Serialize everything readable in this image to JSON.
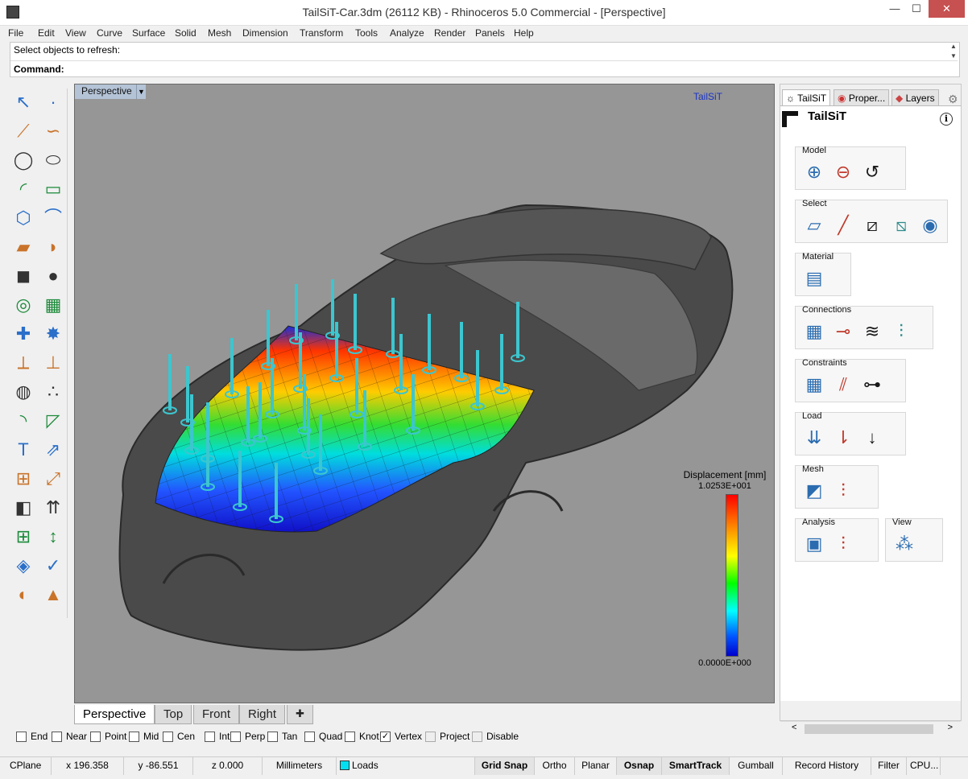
{
  "window": {
    "title": "TailSiT-Car.3dm (26112 KB) - Rhinoceros 5.0 Commercial - [Perspective]",
    "min": "—",
    "max": "☐",
    "close": "✕"
  },
  "menu": [
    "File",
    "Edit",
    "View",
    "Curve",
    "Surface",
    "Solid",
    "Mesh",
    "Dimension",
    "Transform",
    "Tools",
    "Analyze",
    "Render",
    "Panels",
    "Help"
  ],
  "command": {
    "history": "Select objects to refresh:",
    "prompt": "Command:",
    "up": "▲",
    "down": "▼"
  },
  "toolbar": {
    "icons": [
      "select-arrow-icon",
      "point-icon",
      "polyline-icon",
      "curve-icon",
      "circle-icon",
      "ellipse-icon",
      "arc-icon",
      "rectangle-icon",
      "polygon-icon",
      "fillet-icon",
      "surface-corner-icon",
      "surface-sweep-icon",
      "box-icon",
      "sphere-icon",
      "cylinder-icon",
      "mesh-plane-icon",
      "join-icon",
      "explode-icon",
      "trim-icon",
      "split-icon",
      "boolean-icon",
      "group-icon",
      "offset-icon",
      "chamfer-icon",
      "text-icon",
      "move-icon",
      "array-icon",
      "scale-icon",
      "layer-box-icon",
      "loads-arrows-icon",
      "grid-array-icon",
      "dimension-icon",
      "render-icon",
      "check-icon",
      "shade-icon",
      "pyramid-icon"
    ]
  },
  "viewport": {
    "label": "Perspective",
    "dropdown": "▼",
    "brand": "TailSiT",
    "legend": {
      "title": "Displacement [mm]",
      "max": "1.0253E+001",
      "min": "0.0000E+000"
    },
    "tabs": [
      "Perspective",
      "Top",
      "Front",
      "Right",
      "✚"
    ],
    "active_tab": "Perspective"
  },
  "panel": {
    "tabs": [
      "TailSiT",
      "Proper...",
      "Layers"
    ],
    "active": "TailSiT",
    "heading": "TailSiT",
    "info": "i",
    "groups": [
      {
        "label": "Model",
        "icons": [
          "add-surface-icon",
          "remove-surface-icon",
          "reset-icon"
        ]
      },
      {
        "label": "Select",
        "icons": [
          "select-surface-icon",
          "select-line-icon",
          "select-beam-icon",
          "select-beam-2-icon",
          "select-node-icon"
        ]
      },
      {
        "label": "Material",
        "icons": [
          "material-layers-icon"
        ]
      },
      {
        "label": "Connections",
        "icons": [
          "connection-surface-icon",
          "connection-spring-icon",
          "connection-joint-icon",
          "connection-settings-icon"
        ]
      },
      {
        "label": "Constraints",
        "icons": [
          "constraint-surface-icon",
          "constraint-line-icon",
          "constraint-node-icon"
        ]
      },
      {
        "label": "Load",
        "icons": [
          "load-surface-icon",
          "load-line-icon",
          "load-node-icon"
        ]
      },
      {
        "label": "Mesh",
        "icons": [
          "mesh-surface-icon",
          "mesh-settings-icon"
        ]
      },
      {
        "label": "Analysis",
        "icons": [
          "calculator-icon",
          "analysis-settings-icon"
        ]
      },
      {
        "label": "View",
        "icons": [
          "view-results-icon"
        ]
      }
    ]
  },
  "osnap": [
    {
      "label": "End",
      "checked": false
    },
    {
      "label": "Near",
      "checked": false
    },
    {
      "label": "Point",
      "checked": false
    },
    {
      "label": "Mid",
      "checked": false
    },
    {
      "label": "Cen",
      "checked": false
    },
    {
      "label": "Int",
      "checked": false
    },
    {
      "label": "Perp",
      "checked": false
    },
    {
      "label": "Tan",
      "checked": false
    },
    {
      "label": "Quad",
      "checked": false
    },
    {
      "label": "Knot",
      "checked": false
    },
    {
      "label": "Vertex",
      "checked": true
    },
    {
      "label": "Project",
      "checked": false,
      "disabled": true
    },
    {
      "label": "Disable",
      "checked": false,
      "disabled": true
    }
  ],
  "status": {
    "cplane": "CPlane",
    "x": "x 196.358",
    "y": "y -86.551",
    "z": "z 0.000",
    "units": "Millimeters",
    "layer": "Loads",
    "layer_color": "#00e0f0",
    "grid_snap": "Grid Snap",
    "ortho": "Ortho",
    "planar": "Planar",
    "osnap": "Osnap",
    "smarttrack": "SmartTrack",
    "gumball": "Gumball",
    "record": "Record History",
    "filter": "Filter",
    "cpu": "CPU..."
  },
  "colors": {
    "viewport_bg": "#969696",
    "title_bar": "#ffffff",
    "accent_blue": "#1a33c8"
  }
}
